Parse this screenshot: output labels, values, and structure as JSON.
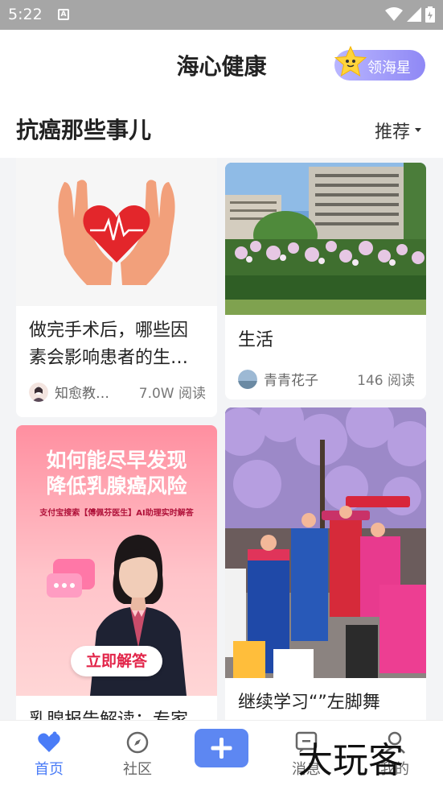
{
  "status_bar": {
    "time": "5:22",
    "sim_label": "A"
  },
  "header": {
    "title": "海心健康",
    "star_button_label": "领海星"
  },
  "section": {
    "title": "抗癌那些事儿",
    "sort_label": "推荐"
  },
  "cards": [
    {
      "title_line1": "做完手术后，哪些因",
      "title_line2": "素会影响患者的生…",
      "author": "知愈教…",
      "reads": "7.0W 阅读"
    },
    {
      "title": "生活",
      "author": "青青花子",
      "reads": "146 阅读"
    },
    {
      "promo_heading_line1": "如何能尽早发现",
      "promo_heading_line2": "降低乳腺癌风险",
      "promo_sub": "支付宝搜索【傅佩芬医生】AI助理实时解答",
      "promo_button": "立即解答",
      "title": "乳腺报告解读：专家"
    },
    {
      "title": "继续学习“”左脚舞"
    }
  ],
  "tabbar": {
    "tabs": [
      {
        "label": "首页",
        "icon": "heart-icon"
      },
      {
        "label": "社区",
        "icon": "compass-icon"
      },
      {
        "label": "",
        "icon": "plus-icon"
      },
      {
        "label": "消息",
        "icon": "message-icon"
      },
      {
        "label": "我的",
        "icon": "user-icon"
      }
    ]
  },
  "watermark": "大玩客",
  "colors": {
    "accent": "#4a7cf7",
    "add_button": "#5d87f2",
    "star_gradient_start": "#b9b6ff",
    "star_gradient_end": "#8f88f5",
    "heart_red": "#e3262b"
  }
}
